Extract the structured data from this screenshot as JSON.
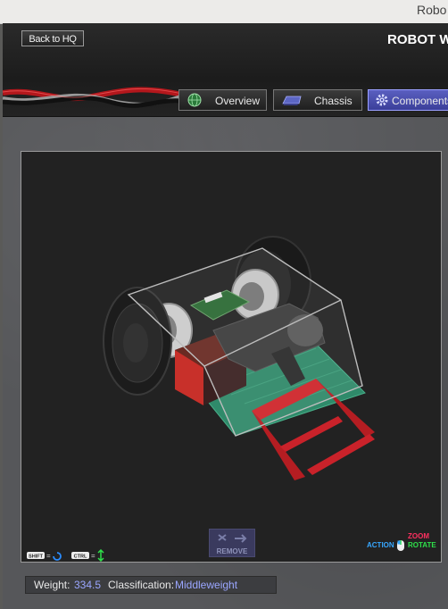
{
  "window": {
    "title": "Robo"
  },
  "header": {
    "back_label": "Back to HQ",
    "app_title": "ROBOT W",
    "tabs": [
      {
        "label": "Overview",
        "icon": "globe-icon",
        "active": false
      },
      {
        "label": "Chassis",
        "icon": "chassis-icon",
        "active": false
      },
      {
        "label": "Components",
        "icon": "gear-icon",
        "active": true
      }
    ]
  },
  "viewport": {
    "shift_key": "SHIFT",
    "ctrl_key": "CTRL",
    "remove_label": "REMOVE",
    "camera": {
      "zoom": "ZOOM",
      "action": "ACTION",
      "rotate": "ROTATE"
    }
  },
  "status": {
    "weight_label": "Weight:",
    "weight_value": "334.5",
    "class_label": "Classification:",
    "class_value": "Middleweight"
  },
  "colors": {
    "accent": "#5a5fc0",
    "value_text": "#9aa6ff",
    "zoom": "#ff3060",
    "action": "#37a7ff",
    "rotate": "#2ee04a"
  }
}
